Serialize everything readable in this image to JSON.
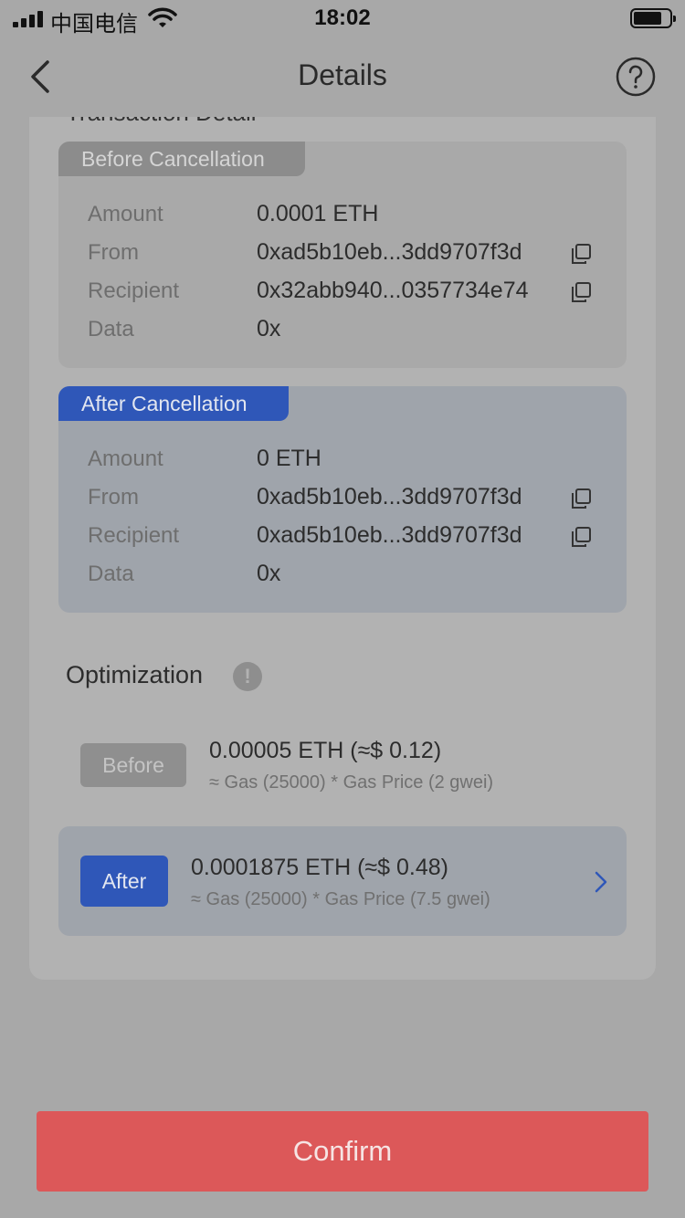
{
  "status_bar": {
    "carrier": "中国电信",
    "time": "18:02"
  },
  "nav": {
    "title": "Details",
    "back_icon": "chevron-left-icon",
    "help_icon": "question-circle-icon"
  },
  "section_heading": "Transaction Detail",
  "before_cancellation": {
    "tag": "Before Cancellation",
    "rows": [
      {
        "label": "Amount",
        "value": "0.0001 ETH"
      },
      {
        "label": "From",
        "value": "0xad5b10eb...3dd9707f3d"
      },
      {
        "label": "Recipient",
        "value": "0x32abb940...0357734e74"
      },
      {
        "label": "Data",
        "value": "0x"
      }
    ]
  },
  "after_cancellation": {
    "tag": "After Cancellation",
    "rows": [
      {
        "label": "Amount",
        "value": "0 ETH"
      },
      {
        "label": "From",
        "value": "0xad5b10eb...3dd9707f3d"
      },
      {
        "label": "Recipient",
        "value": "0xad5b10eb...3dd9707f3d"
      },
      {
        "label": "Data",
        "value": "0x"
      }
    ]
  },
  "optimization": {
    "title": "Optimization",
    "info_icon": "!",
    "before": {
      "label": "Before",
      "fee": "0.00005 ETH (≈$ 0.12)",
      "formula": "≈ Gas (25000) * Gas Price (2 gwei)"
    },
    "after": {
      "label": "After",
      "fee": "0.0001875 ETH (≈$ 0.48)",
      "formula": "≈ Gas (25000) * Gas Price (7.5 gwei)"
    }
  },
  "confirm_label": "Confirm",
  "colors": {
    "accent": "#2f57b8",
    "confirm": "#dc5859",
    "overlay": "#a8a8a8"
  }
}
